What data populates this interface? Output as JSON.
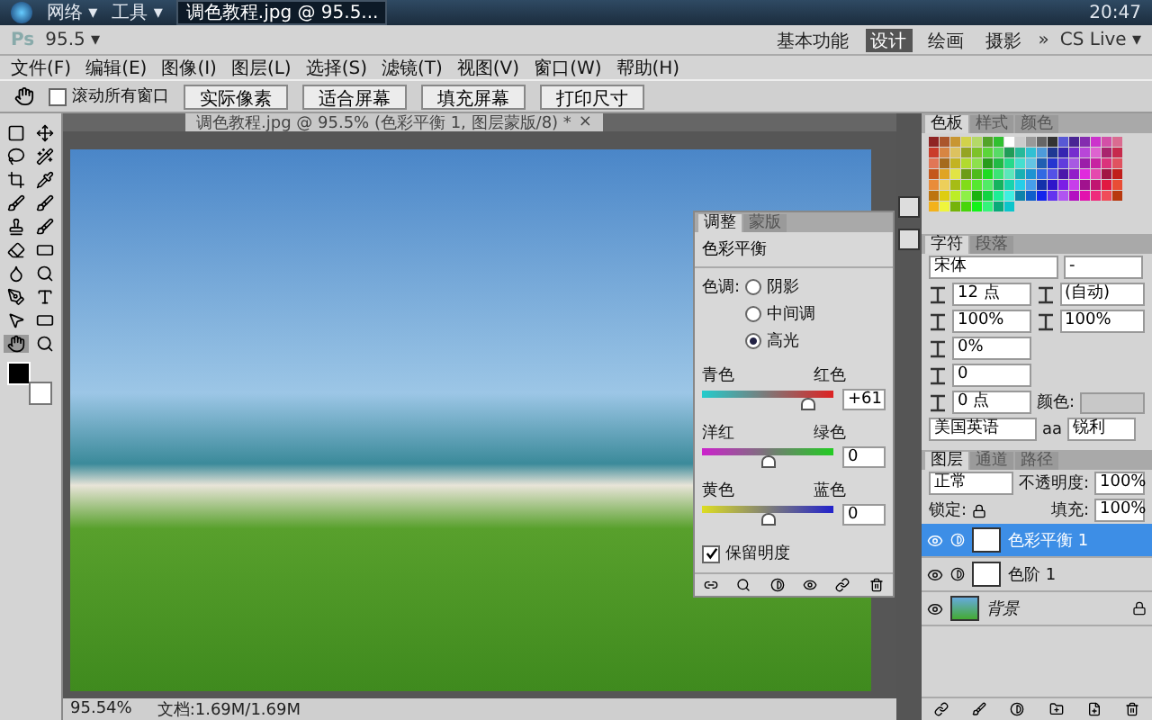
{
  "taskbar": {
    "menus": [
      "网络 ▾",
      "工具 ▾"
    ],
    "task": "调色教程.jpg @ 95.5...",
    "time": "20:47"
  },
  "app_bar": {
    "logo": "Ps",
    "zoom": "95.5 ▾",
    "workspaces": [
      {
        "label": "基本功能",
        "selected": false
      },
      {
        "label": "设计",
        "selected": true
      },
      {
        "label": "绘画",
        "selected": false
      },
      {
        "label": "摄影",
        "selected": false
      }
    ],
    "more": "»",
    "cs_live": "CS Live ▾"
  },
  "menu": [
    "文件(F)",
    "编辑(E)",
    "图像(I)",
    "图层(L)",
    "选择(S)",
    "滤镜(T)",
    "视图(V)",
    "窗口(W)",
    "帮助(H)"
  ],
  "options": {
    "scroll_all": {
      "label": "滚动所有窗口",
      "checked": false
    },
    "buttons": [
      "实际像素",
      "适合屏幕",
      "填充屏幕",
      "打印尺寸"
    ]
  },
  "document": {
    "tab": "调色教程.jpg @ 95.5% (色彩平衡 1, 图层蒙版/8) *",
    "close": "×",
    "zoom": "95.54%",
    "doc_size": "文档:1.69M/1.69M"
  },
  "adjustments": {
    "tabs": [
      {
        "label": "调整",
        "selected": true
      },
      {
        "label": "蒙版",
        "selected": false
      }
    ],
    "title": "色彩平衡",
    "tone_label": "色调:",
    "tones": [
      {
        "label": "阴影",
        "selected": false
      },
      {
        "label": "中间调",
        "selected": false
      },
      {
        "label": "高光",
        "selected": true
      }
    ],
    "sliders": [
      {
        "left": "青色",
        "right": "红色",
        "value": "+61",
        "level": 0.8,
        "kind": "cyan-red"
      },
      {
        "left": "洋红",
        "right": "绿色",
        "value": "0",
        "level": 0.5,
        "kind": "magenta-green"
      },
      {
        "left": "黄色",
        "right": "蓝色",
        "value": "0",
        "level": 0.5,
        "kind": "yellow-blue"
      }
    ],
    "preserve": {
      "label": "保留明度",
      "checked": true
    }
  },
  "swatches": {
    "tabs": [
      {
        "label": "色板",
        "selected": true
      },
      {
        "label": "样式",
        "selected": false
      },
      {
        "label": "颜色",
        "selected": false
      }
    ]
  },
  "character": {
    "tabs": [
      {
        "label": "字符",
        "selected": true
      },
      {
        "label": "段落",
        "selected": false
      }
    ],
    "font": "宋体",
    "style": "-",
    "size": "12 点",
    "leading": "(自动)",
    "vscale": "100%",
    "hscale": "100%",
    "tracking": "0%",
    "kerning": "0",
    "baseline": "0 点",
    "color_label": "颜色:",
    "language": "美国英语",
    "aa_label": "aa",
    "antialias": "锐利"
  },
  "layers": {
    "tabs": [
      {
        "label": "图层",
        "selected": true
      },
      {
        "label": "通道",
        "selected": false
      },
      {
        "label": "路径",
        "selected": false
      }
    ],
    "blend": "正常",
    "opacity_label": "不透明度:",
    "opacity": "100%",
    "lock_label": "锁定:",
    "fill_label": "填充:",
    "fill": "100%",
    "items": [
      {
        "name": "色彩平衡 1",
        "kind": "adjustment",
        "selected": true,
        "visible": true
      },
      {
        "name": "色阶 1",
        "kind": "adjustment",
        "selected": false,
        "visible": true
      },
      {
        "name": "背景",
        "kind": "background",
        "selected": false,
        "visible": true
      }
    ]
  }
}
